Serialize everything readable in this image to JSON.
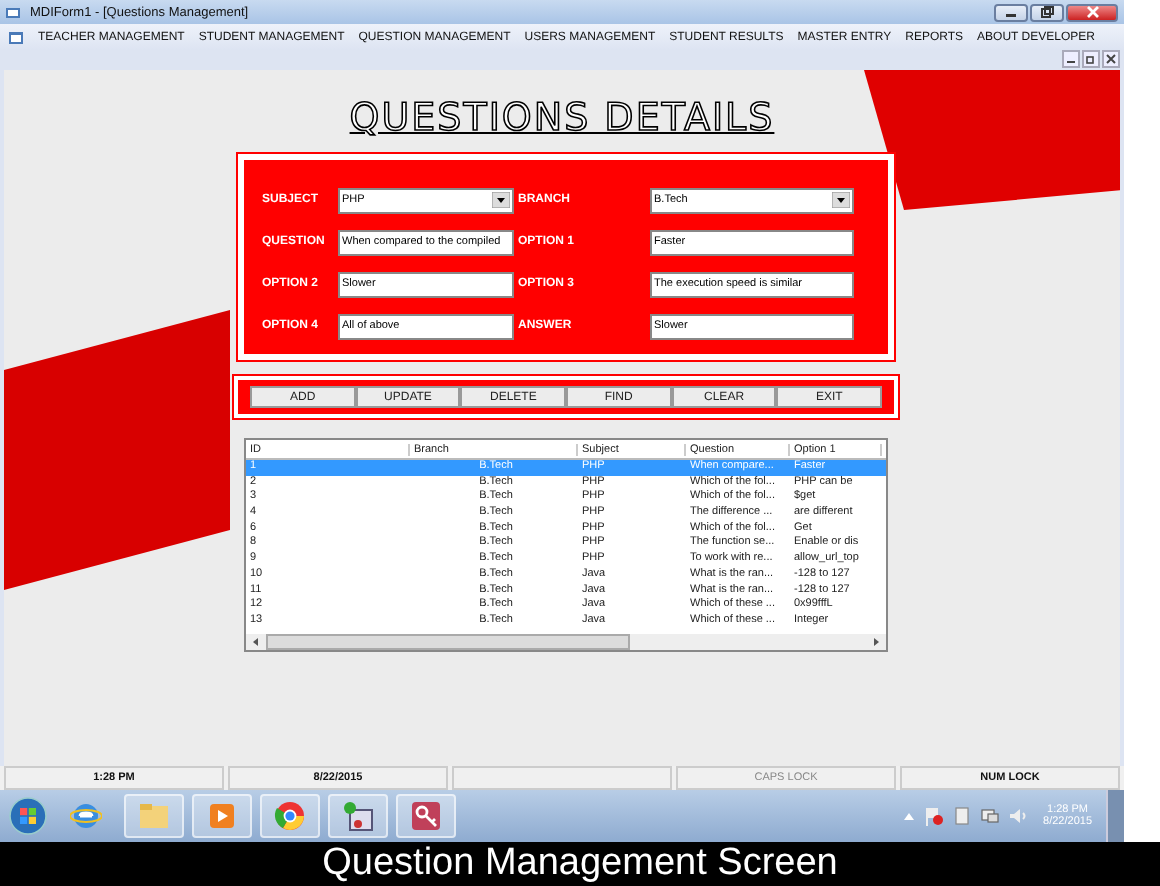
{
  "window": {
    "title": "MDIForm1 - [Questions Management]"
  },
  "menu": [
    "TEACHER MANAGEMENT",
    "STUDENT MANAGEMENT",
    "QUESTION MANAGEMENT",
    "USERS MANAGEMENT",
    "STUDENT RESULTS",
    "MASTER ENTRY",
    "REPORTS",
    "ABOUT DEVELOPER"
  ],
  "heading": "QUESTIONS DETAILS",
  "form": {
    "fields": [
      {
        "label": "SUBJECT",
        "kind": "dropdown",
        "value": "PHP"
      },
      {
        "label": "BRANCH",
        "kind": "dropdown",
        "value": "B.Tech"
      },
      {
        "label": "QUESTION",
        "kind": "text",
        "value": "When compared to the compiled"
      },
      {
        "label": "OPTION 1",
        "kind": "text",
        "value": "Faster"
      },
      {
        "label": "OPTION 2",
        "kind": "text",
        "value": "Slower"
      },
      {
        "label": "OPTION 3",
        "kind": "text",
        "value": "The execution speed is similar"
      },
      {
        "label": "OPTION 4",
        "kind": "text",
        "value": "All of above"
      },
      {
        "label": "ANSWER",
        "kind": "text",
        "value": "Slower"
      }
    ]
  },
  "buttons": [
    "ADD",
    "UPDATE",
    "DELETE",
    "FIND",
    "CLEAR",
    "EXIT"
  ],
  "table": {
    "columns": [
      "ID",
      "Branch",
      "Subject",
      "Question",
      "Option 1"
    ],
    "rows": [
      {
        "cells": [
          "1",
          "B.Tech",
          "PHP",
          "When compare...",
          "Faster"
        ],
        "selected": true
      },
      {
        "cells": [
          "2",
          "B.Tech",
          "PHP",
          "Which of the fol...",
          "PHP can be"
        ],
        "selected": false
      },
      {
        "cells": [
          "3",
          "B.Tech",
          "PHP",
          "Which of the fol...",
          "$get"
        ],
        "selected": false
      },
      {
        "cells": [
          "4",
          "B.Tech",
          "PHP",
          "The difference ...",
          "are different"
        ],
        "selected": false
      },
      {
        "cells": [
          "6",
          "B.Tech",
          "PHP",
          "Which of the fol...",
          "Get"
        ],
        "selected": false
      },
      {
        "cells": [
          "8",
          "B.Tech",
          "PHP",
          "The function se...",
          "Enable or dis"
        ],
        "selected": false
      },
      {
        "cells": [
          "9",
          "B.Tech",
          "PHP",
          "To work with re...",
          "allow_url_top"
        ],
        "selected": false
      },
      {
        "cells": [
          "10",
          "B.Tech",
          "Java",
          "What is the ran...",
          "-128 to 127"
        ],
        "selected": false
      },
      {
        "cells": [
          "11",
          "B.Tech",
          "Java",
          "What is the ran...",
          "-128 to 127"
        ],
        "selected": false
      },
      {
        "cells": [
          "12",
          "B.Tech",
          "Java",
          "Which of these ...",
          "0x99fffL"
        ],
        "selected": false
      },
      {
        "cells": [
          "13",
          "B.Tech",
          "Java",
          "Which of these ...",
          "Integer"
        ],
        "selected": false
      }
    ]
  },
  "status_bar": [
    {
      "text": "1:28 PM",
      "on": true
    },
    {
      "text": "8/22/2015",
      "on": true
    },
    {
      "text": "CAPS LOCK",
      "on": false
    },
    {
      "text": "NUM LOCK",
      "on": true
    }
  ],
  "taskbar": {
    "time": "1:28 PM",
    "date": "8/22/2015"
  },
  "caption": "Question Management Screen"
}
